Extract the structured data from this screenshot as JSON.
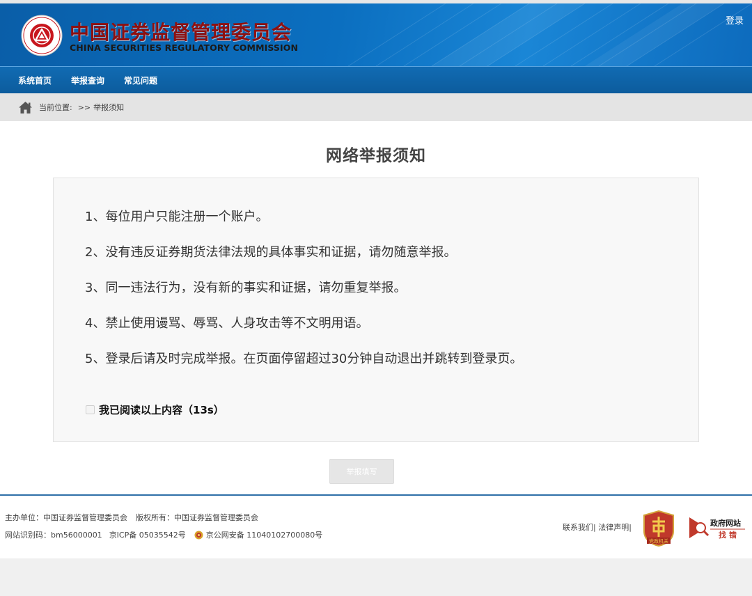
{
  "header": {
    "logo_cn": "中国证券监督管理委员会",
    "logo_en": "CHINA SECURITIES REGULATORY COMMISSION",
    "login_label": "登录"
  },
  "nav": {
    "items": [
      {
        "label": "系统首页"
      },
      {
        "label": "举报查询"
      },
      {
        "label": "常见问题"
      }
    ]
  },
  "breadcrumb": {
    "prefix": "当前位置:",
    "sep": ">>",
    "current": "举报须知"
  },
  "notice": {
    "title": "网络举报须知",
    "rules": [
      "1、每位用户只能注册一个账户。",
      "2、没有违反证券期货法律法规的具体事实和证据，请勿随意举报。",
      "3、同一违法行为，没有新的事实和证据，请勿重复举报。",
      "4、禁止使用谩骂、辱骂、人身攻击等不文明用语。",
      "5、登录后请及时完成举报。在页面停留超过30分钟自动退出并跳转到登录页。"
    ],
    "agree_label": "我已阅读以上内容（13s）",
    "submit_label": "举报填写"
  },
  "footer": {
    "sponsor": "主办单位：中国证券监督管理委员会",
    "copyright": "版权所有：中国证券监督管理委员会",
    "site_code": "网站识别码：bm56000001",
    "icp": "京ICP备 05035542号",
    "police": "京公网安备 11040102700080号",
    "links": "联系我们| 法律声明|",
    "badge1_text": "党政机关",
    "badge2_line1": "政府网站",
    "badge2_line2": "找 错"
  },
  "colors": {
    "header_blue": "#0b6fc0",
    "nav_blue": "#0c5c9d",
    "logo_red": "#8e1010",
    "badge_red": "#c0392b"
  }
}
